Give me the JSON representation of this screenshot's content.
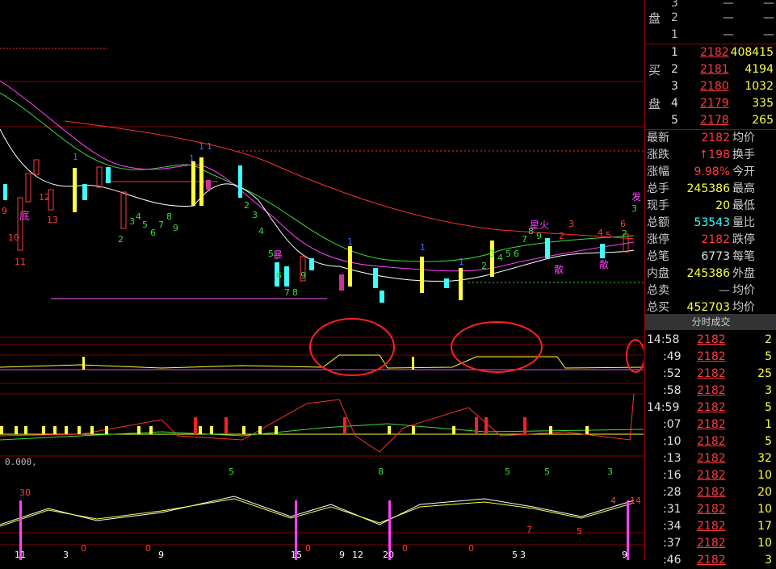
{
  "colors": {
    "up": "#ff3c3c",
    "down": "#3cffff",
    "ma5": "#ffffff",
    "ma10": "#ff40ff",
    "ma20": "#3cdc3c",
    "ma60": "#ff3030",
    "signal": "#ffff3c"
  },
  "chart_labels": {
    "indicator_readout": "0.000,",
    "main_numbers": [
      "9",
      "10",
      "11",
      "12",
      "13",
      "底",
      "2",
      "3",
      "4",
      "5",
      "6",
      "7",
      "8",
      "9",
      "1",
      "1",
      "1",
      "1",
      "2",
      "3",
      "4",
      "5",
      "暴",
      "6",
      "7",
      "8",
      "9",
      "1",
      "1",
      "1",
      "2",
      "3",
      "4",
      "5",
      "6",
      "7",
      "8",
      "9",
      "星火",
      "3",
      "2",
      "4",
      "5",
      "6",
      "2",
      "散",
      "散",
      "发",
      "3"
    ],
    "sub_numbers": [
      "5",
      "8",
      "5",
      "5",
      "3"
    ],
    "bottom_axis": [
      "11",
      "3",
      "0",
      "0",
      "9",
      "15",
      "9",
      "12",
      "20",
      "0",
      "0",
      "5",
      "3",
      "9"
    ],
    "bottom_markers": [
      "30",
      "0",
      "4",
      "14",
      "7",
      "5"
    ]
  },
  "orderbook": {
    "sell_label": [
      "盘"
    ],
    "sell": [
      {
        "level": "3",
        "price": "—",
        "vol": "—"
      },
      {
        "level": "2",
        "price": "—",
        "vol": "—"
      },
      {
        "level": "1",
        "price": "—",
        "vol": "—"
      }
    ],
    "buy_label": [
      "买",
      "盘"
    ],
    "buy": [
      {
        "level": "1",
        "price": "2182",
        "vol": "408415"
      },
      {
        "level": "2",
        "price": "2181",
        "vol": "4194"
      },
      {
        "level": "3",
        "price": "2180",
        "vol": "1032"
      },
      {
        "level": "4",
        "price": "2179",
        "vol": "335"
      },
      {
        "level": "5",
        "price": "2178",
        "vol": "265"
      }
    ]
  },
  "quote": [
    {
      "label": "最新",
      "value": "2182",
      "label2": "均价",
      "vcls": "red"
    },
    {
      "label": "涨跌",
      "value": "↑198",
      "label2": "换手",
      "vcls": "red"
    },
    {
      "label": "涨幅",
      "value": "9.98%",
      "label2": "今开",
      "vcls": "red"
    },
    {
      "label": "总手",
      "value": "245386",
      "label2": "最高",
      "vcls": "yellow"
    },
    {
      "label": "现手",
      "value": "20",
      "label2": "最低",
      "vcls": "yellow"
    },
    {
      "label": "总额",
      "value": "53543",
      "label2": "量比",
      "vcls": "cyan"
    },
    {
      "label": "涨停",
      "value": "2182",
      "label2": "跌停",
      "vcls": "red"
    },
    {
      "label": "总笔",
      "value": "6773",
      "label2": "每笔",
      "vcls": "white"
    },
    {
      "label": "内盘",
      "value": "245386",
      "label2": "外盘",
      "vcls": "yellow"
    },
    {
      "label": "总卖",
      "value": "—",
      "label2": "均价",
      "vcls": "grey"
    },
    {
      "label": "总买",
      "value": "452703",
      "label2": "均价",
      "vcls": "yellow"
    }
  ],
  "ticks_tab": "分时成交",
  "ticks": [
    {
      "time": "14:58",
      "price": "2182",
      "vol": "2"
    },
    {
      "time": ":49",
      "price": "2182",
      "vol": "5"
    },
    {
      "time": ":52",
      "price": "2182",
      "vol": "25"
    },
    {
      "time": ":58",
      "price": "2182",
      "vol": "3"
    },
    {
      "time": "14:59",
      "price": "2182",
      "vol": "5"
    },
    {
      "time": ":07",
      "price": "2182",
      "vol": "1"
    },
    {
      "time": ":10",
      "price": "2182",
      "vol": "5"
    },
    {
      "time": ":13",
      "price": "2182",
      "vol": "32"
    },
    {
      "time": ":16",
      "price": "2182",
      "vol": "10"
    },
    {
      "time": ":28",
      "price": "2182",
      "vol": "20"
    },
    {
      "time": ":31",
      "price": "2182",
      "vol": "10"
    },
    {
      "time": ":34",
      "price": "2182",
      "vol": "17"
    },
    {
      "time": ":37",
      "price": "2182",
      "vol": "10"
    },
    {
      "time": ":46",
      "price": "2182",
      "vol": "3"
    }
  ]
}
